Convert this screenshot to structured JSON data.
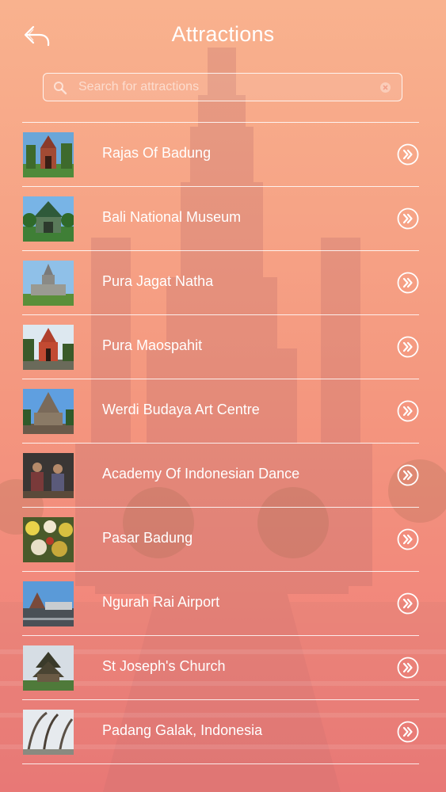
{
  "header": {
    "title": "Attractions",
    "back_icon": "back-arrow-icon"
  },
  "search": {
    "placeholder": "Search for attractions",
    "value": "",
    "icon": "search-icon",
    "clear_icon": "clear-icon"
  },
  "colors": {
    "background_top": "#f7a98a",
    "background_bottom": "#ef7d79",
    "foreground": "#ffffff"
  },
  "attractions": [
    {
      "label": "Rajas Of Badung",
      "thumb_icon": "temple-gate-photo-icon"
    },
    {
      "label": "Bali National Museum",
      "thumb_icon": "museum-building-photo-icon"
    },
    {
      "label": "Pura Jagat Natha",
      "thumb_icon": "temple-tower-photo-icon"
    },
    {
      "label": "Pura Maospahit",
      "thumb_icon": "red-temple-gate-photo-icon"
    },
    {
      "label": "Werdi Budaya Art Centre",
      "thumb_icon": "art-centre-photo-icon"
    },
    {
      "label": "Academy Of Indonesian Dance",
      "thumb_icon": "dance-performance-photo-icon"
    },
    {
      "label": "Pasar Badung",
      "thumb_icon": "market-offerings-photo-icon"
    },
    {
      "label": "Ngurah Rai Airport",
      "thumb_icon": "airport-photo-icon"
    },
    {
      "label": "St Joseph's Church",
      "thumb_icon": "church-photo-icon"
    },
    {
      "label": "Padang Galak, Indonesia",
      "thumb_icon": "penjor-poles-photo-icon"
    }
  ],
  "row_action_icon": "double-chevron-right-icon"
}
